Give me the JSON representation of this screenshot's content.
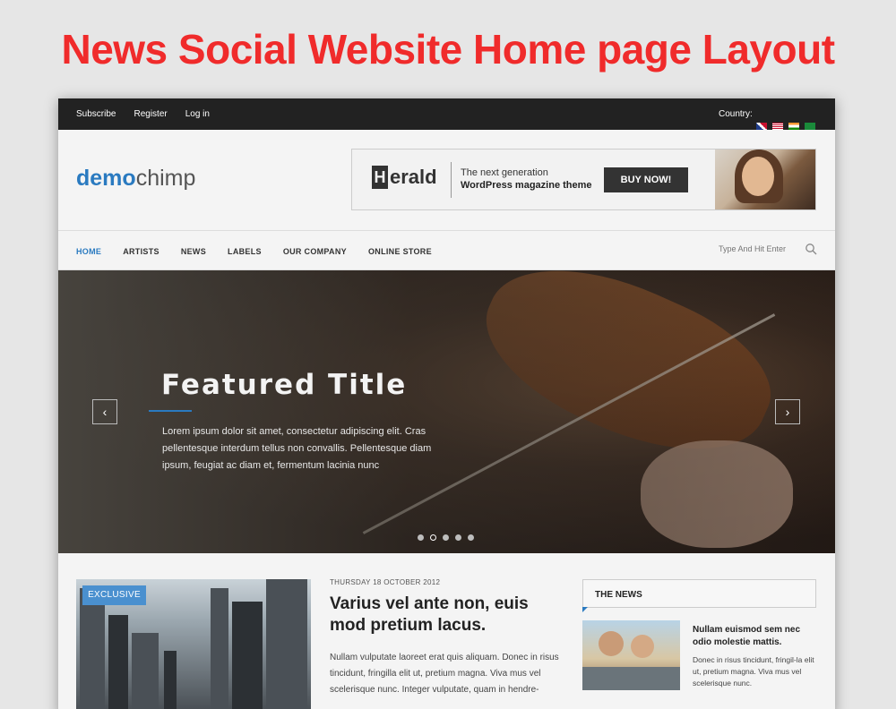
{
  "banner": {
    "title": "News Social Website Home page Layout"
  },
  "topbar": {
    "links": [
      "Subscribe",
      "Register",
      "Log in"
    ],
    "country_label": "Country:",
    "flags": [
      "uk-flag",
      "us-flag",
      "india-flag",
      "saudi-flag"
    ]
  },
  "header": {
    "logo_part1": "demo",
    "logo_part2": "chimp",
    "ad": {
      "brand": "erald",
      "brand_letter": "H",
      "tagline1": "The next generation",
      "tagline2": "WordPress magazine theme",
      "button": "BUY NOW!"
    }
  },
  "nav": {
    "items": [
      "HOME",
      "ARTISTS",
      "NEWS",
      "LABELS",
      "OUR COMPANY",
      "ONLINE STORE"
    ],
    "active_index": 0,
    "search_placeholder": "Type And Hit Enter"
  },
  "hero": {
    "title": "Featured Title",
    "description": "Lorem ipsum dolor sit amet, consectetur adipiscing elit. Cras pellentesque interdum tellus non convallis. Pellentesque diam ipsum, feugiat ac diam et, fermentum lacinia nunc",
    "prev_glyph": "‹",
    "next_glyph": "›",
    "slides": 5,
    "active_slide": 1
  },
  "article": {
    "badge": "EXCLUSIVE",
    "date": "THURSDAY 18 OCTOBER 2012",
    "headline": "Varius vel ante non, euis mod pretium lacus.",
    "body": "Nullam vulputate laoreet erat quis aliquam. Donec in risus tincidunt, fringilla elit ut, pretium magna. Viva mus vel scelerisque nunc. Integer vulputate, quam in hendre-"
  },
  "sidebar": {
    "heading": "THE NEWS",
    "item_title": "Nullam euismod sem nec odio molestie mattis.",
    "item_desc": "Donec in risus tincidunt, fringil-la elit ut, pretium magna. Viva mus vel scelerisque nunc."
  },
  "colors": {
    "banner_red": "#f02b2b",
    "accent_blue": "#2a7ac0",
    "badge_blue": "#4a90cf",
    "topbar_bg": "#222222"
  }
}
